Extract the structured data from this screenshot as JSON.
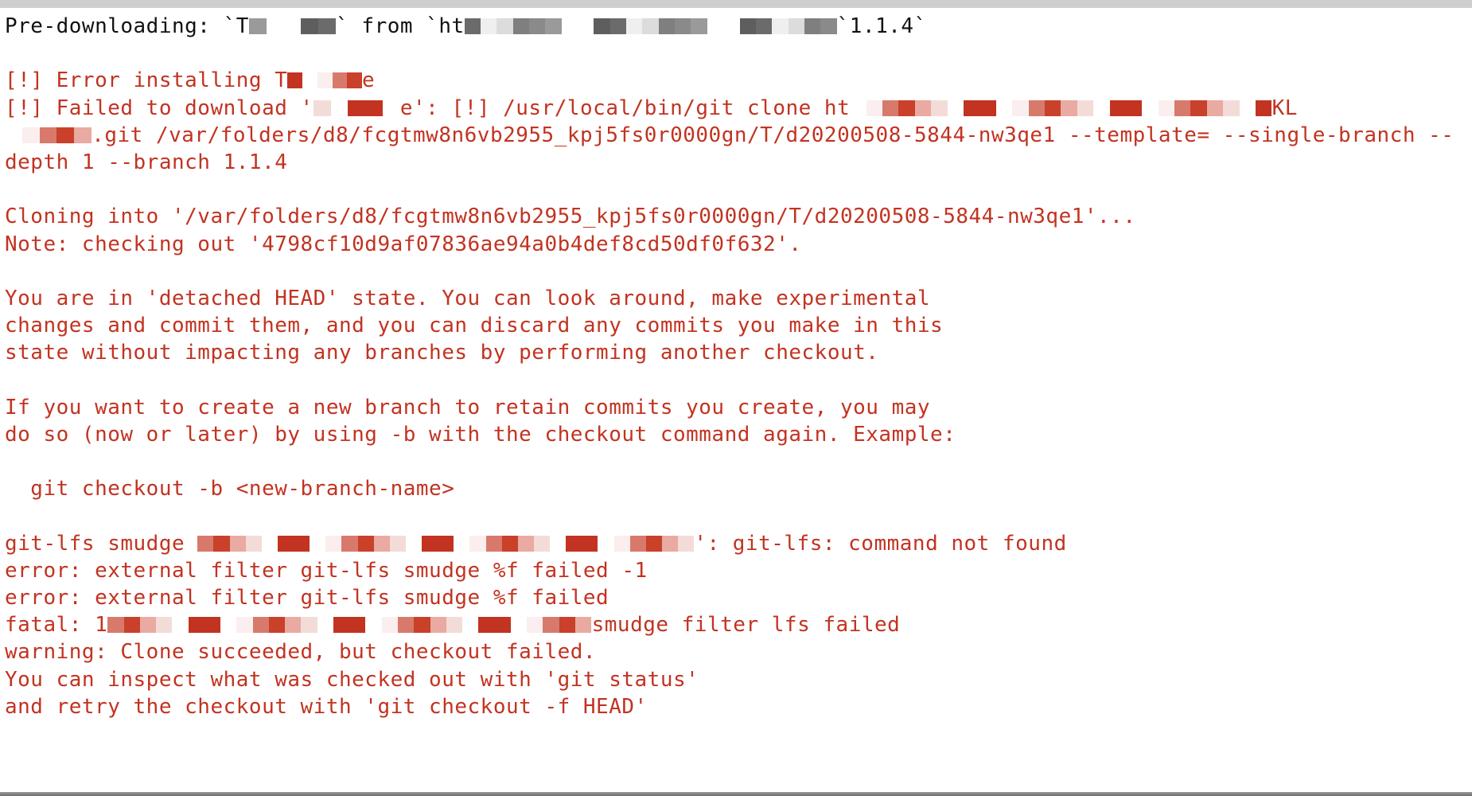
{
  "colors": {
    "error_text": "#C23321",
    "normal_text": "#111111",
    "background": "#FFFFFF"
  },
  "terminal": {
    "lines": [
      {
        "style": "black",
        "segments": [
          {
            "t": "Pre-downloading: `T"
          },
          {
            "r": "gray",
            "n": 7
          },
          {
            "t": "` from `ht"
          },
          {
            "r": "gray",
            "n": 30
          },
          {
            "t": "`1.1.4`"
          }
        ]
      },
      {
        "style": "blank",
        "segments": []
      },
      {
        "style": "red",
        "segments": [
          {
            "t": "[!] Error installing T"
          },
          {
            "r": "red",
            "n": 6
          },
          {
            "t": "e"
          }
        ]
      },
      {
        "style": "red",
        "segments": [
          {
            "t": "[!] Failed to download '"
          },
          {
            "r": "red",
            "n": 7
          },
          {
            "t": "e': [!] /usr/local/bin/git clone ht"
          },
          {
            "r": "red",
            "n": 34
          },
          {
            "t": "KL"
          }
        ]
      },
      {
        "style": "red",
        "segments": [
          {
            "r": "red",
            "n": 7
          },
          {
            "t": ".git /var/folders/d8/fcgtmw8n6vb2955_kpj5fs0r0000gn/T/d20200508-5844-nw3qe1 --template= --single-branch --"
          }
        ]
      },
      {
        "style": "red",
        "segments": [
          {
            "t": "depth 1 --branch 1.1.4"
          }
        ]
      },
      {
        "style": "blank",
        "segments": []
      },
      {
        "style": "red",
        "segments": [
          {
            "t": "Cloning into '/var/folders/d8/fcgtmw8n6vb2955_kpj5fs0r0000gn/T/d20200508-5844-nw3qe1'..."
          }
        ]
      },
      {
        "style": "red",
        "segments": [
          {
            "t": "Note: checking out '4798cf10d9af07836ae94a0b4def8cd50df0f632'."
          }
        ]
      },
      {
        "style": "blank",
        "segments": []
      },
      {
        "style": "red",
        "segments": [
          {
            "t": "You are in 'detached HEAD' state. You can look around, make experimental"
          }
        ]
      },
      {
        "style": "red",
        "segments": [
          {
            "t": "changes and commit them, and you can discard any commits you make in this"
          }
        ]
      },
      {
        "style": "red",
        "segments": [
          {
            "t": "state without impacting any branches by performing another checkout."
          }
        ]
      },
      {
        "style": "blank",
        "segments": []
      },
      {
        "style": "red",
        "segments": [
          {
            "t": "If you want to create a new branch to retain commits you create, you may"
          }
        ]
      },
      {
        "style": "red",
        "segments": [
          {
            "t": "do so (now or later) by using -b with the checkout command again. Example:"
          }
        ]
      },
      {
        "style": "blank",
        "segments": []
      },
      {
        "style": "red",
        "segments": [
          {
            "t": "  git checkout -b <new-branch-name>"
          }
        ]
      },
      {
        "style": "blank",
        "segments": []
      },
      {
        "style": "red",
        "segments": [
          {
            "t": "git-lfs smudge "
          },
          {
            "r": "red",
            "n": 40
          },
          {
            "t": "': git-lfs: command not found"
          }
        ]
      },
      {
        "style": "red",
        "segments": [
          {
            "t": "error: external filter git-lfs smudge %f failed -1"
          }
        ]
      },
      {
        "style": "red",
        "segments": [
          {
            "t": "error: external filter git-lfs smudge %f failed"
          }
        ]
      },
      {
        "style": "red",
        "segments": [
          {
            "t": "fatal: 1"
          },
          {
            "r": "red",
            "n": 39
          },
          {
            "t": "smudge filter lfs failed"
          }
        ]
      },
      {
        "style": "red",
        "segments": [
          {
            "t": "warning: Clone succeeded, but checkout failed."
          }
        ]
      },
      {
        "style": "red",
        "segments": [
          {
            "t": "You can inspect what was checked out with 'git status'"
          }
        ]
      },
      {
        "style": "red",
        "segments": [
          {
            "t": "and retry the checkout with 'git checkout -f HEAD'"
          }
        ]
      }
    ]
  }
}
